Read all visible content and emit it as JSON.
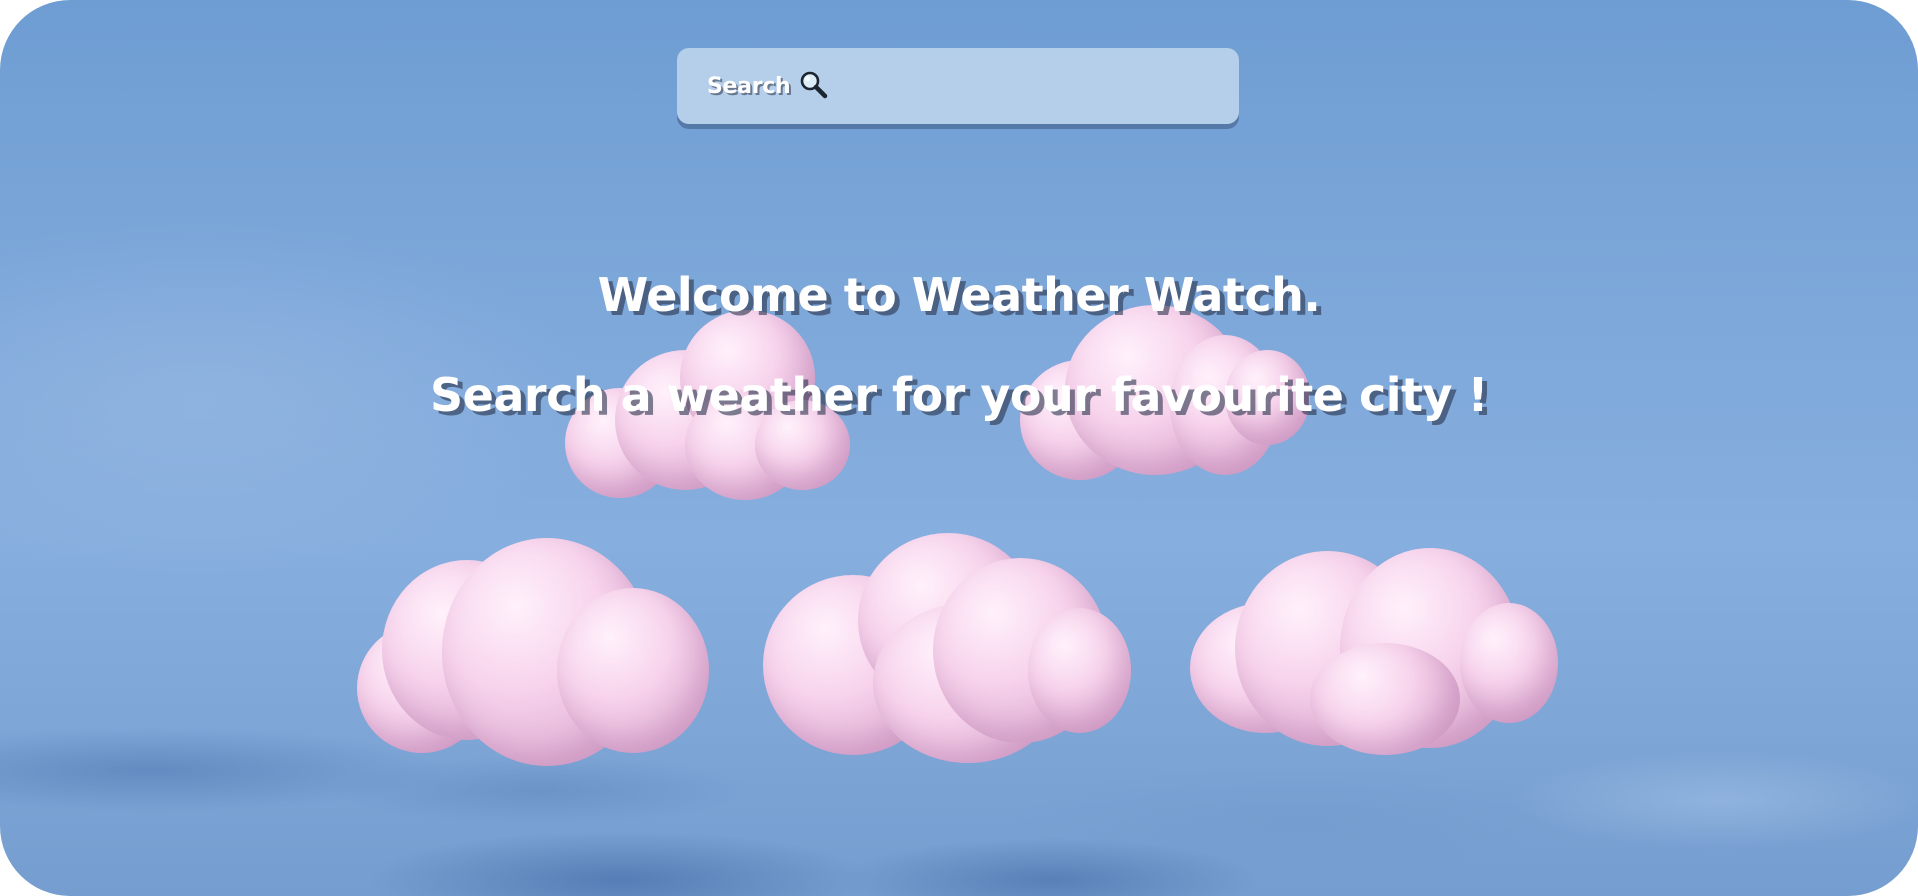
{
  "search": {
    "label": "Search",
    "icon": "magnifier-icon"
  },
  "welcome": {
    "title": "Welcome to Weather Watch.",
    "subtitle": "Search a weather for your favourite city !"
  },
  "theme": {
    "sky": "#7ea8da",
    "cloud": "#f0c6e4",
    "text": "#ffffff"
  },
  "decorations": {
    "clouds": [
      "cloud-icon",
      "cloud-icon",
      "cloud-icon",
      "cloud-icon",
      "cloud-icon"
    ]
  }
}
